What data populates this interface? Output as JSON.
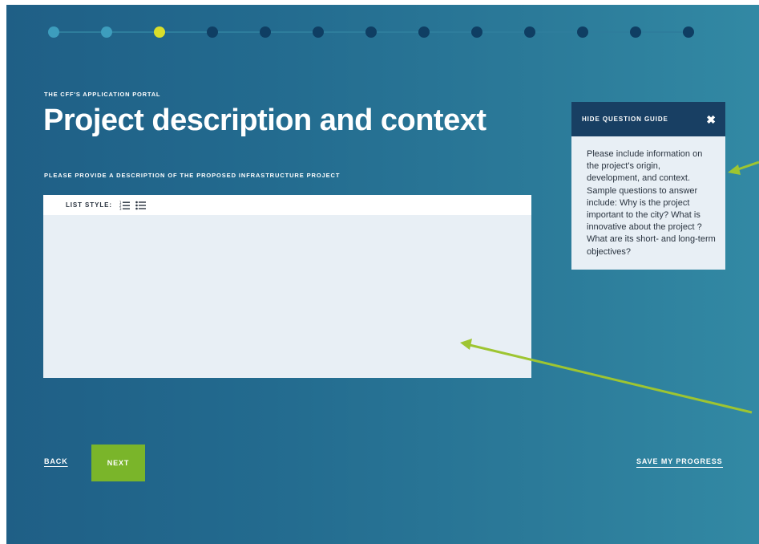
{
  "progress": {
    "total_steps": 13,
    "current_step": 3,
    "colors": {
      "done": "#3d9dbd",
      "current": "#d9de2b",
      "upcoming": "#0f3e63"
    }
  },
  "header": {
    "eyebrow": "THE CFF'S APPLICATION PORTAL",
    "title": "Project description and context"
  },
  "question": {
    "prompt": "PLEASE PROVIDE A DESCRIPTION OF THE PROPOSED INFRASTRUCTURE PROJECT"
  },
  "editor": {
    "toolbar_label": "LIST STYLE:",
    "icons": [
      "ordered-list-icon",
      "bullet-list-icon"
    ],
    "value": ""
  },
  "guide": {
    "header_label": "HIDE QUESTION GUIDE",
    "close_icon": "close-icon",
    "body": "Please include information on the project's origin, development, and context. Sample questions to answer include: Why is the project important to the city? What is innovative about the project ? What are its short- and long-term objectives?"
  },
  "footer": {
    "back_label": "BACK",
    "next_label": "NEXT",
    "save_label": "SAVE MY PROGRESS"
  },
  "colors": {
    "accent_green": "#7ab52a",
    "arrow_green": "#9ec531",
    "guide_header": "#183f63"
  }
}
